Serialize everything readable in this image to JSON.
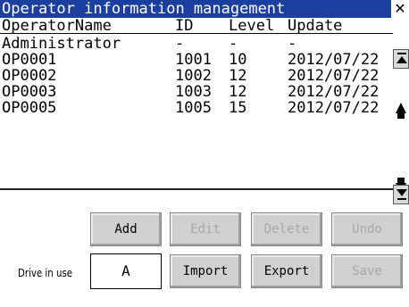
{
  "window": {
    "title": "Operator information management",
    "close_glyph": "✕"
  },
  "table": {
    "headers": [
      "OperatorName",
      "ID",
      "Level",
      "Update"
    ],
    "rows": [
      {
        "name": "Administrator",
        "id": "-",
        "level": "-",
        "update": "-"
      },
      {
        "name": "OP0001",
        "id": "1001",
        "level": "10",
        "update": "2012/07/22"
      },
      {
        "name": "OP0002",
        "id": "1002",
        "level": "12",
        "update": "2012/07/22"
      },
      {
        "name": "OP0003",
        "id": "1003",
        "level": "12",
        "update": "2012/07/22"
      },
      {
        "name": "OP0005",
        "id": "1005",
        "level": "15",
        "update": "2012/07/22"
      }
    ]
  },
  "buttons": {
    "add": "Add",
    "edit": "Edit",
    "delete": "Delete",
    "undo": "Undo",
    "import": "Import",
    "export": "Export",
    "save": "Save"
  },
  "drive": {
    "label": "Drive in use",
    "value": "A"
  },
  "colors": {
    "titlebar": "#1a3f9e",
    "button": "#d0d0d0",
    "disabled_text": "#a8a8a8"
  },
  "icons": {
    "close": "close-icon",
    "scroll_top": "scroll-to-top-icon",
    "page_up": "page-up-icon",
    "page_down": "page-down-icon",
    "scroll_bottom": "scroll-to-bottom-icon"
  }
}
